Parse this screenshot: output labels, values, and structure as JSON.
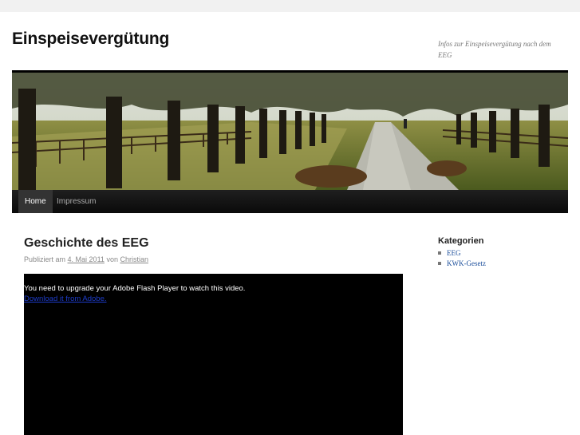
{
  "site": {
    "title": "Einspeisevergütung",
    "description": "Infos zur Einspeisevergütung nach dem EEG"
  },
  "nav": {
    "items": [
      {
        "label": "Home",
        "active": true
      },
      {
        "label": "Impressum",
        "active": false
      }
    ]
  },
  "post": {
    "title": "Geschichte des EEG",
    "meta_prefix": "Publiziert am",
    "date": "4. Mai 2011",
    "meta_by": "von",
    "author": "Christian",
    "flash_message": "You need to upgrade your Adobe Flash Player to watch this video.",
    "flash_link": "Download it from Adobe."
  },
  "sidebar": {
    "widget_title": "Kategorien",
    "categories": [
      "EEG",
      "KWK-Gesetz"
    ]
  },
  "colors": {
    "nav_background": "#111111",
    "link": "#1b4e9b",
    "video_background": "#000000"
  }
}
